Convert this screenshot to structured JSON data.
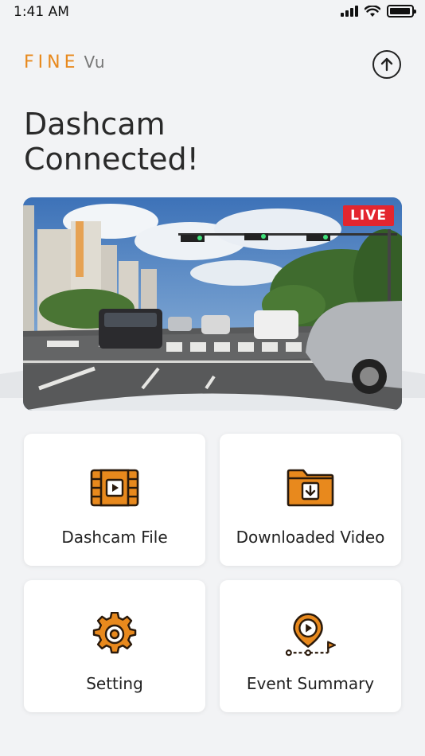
{
  "status_bar": {
    "time": "1:41 AM",
    "battery_level": 0.95
  },
  "header": {
    "brand_part1": "FINE",
    "brand_part2": "Vu",
    "brand_color": "#e8891d"
  },
  "title": {
    "line1": "Dashcam",
    "line2": "Connected!"
  },
  "preview": {
    "badge": "LIVE",
    "badge_color": "#e3262f"
  },
  "actions": [
    {
      "label": "Dashcam File",
      "icon": "film-play-icon"
    },
    {
      "label": "Downloaded Video",
      "icon": "folder-download-icon"
    },
    {
      "label": "Setting",
      "icon": "gear-icon"
    },
    {
      "label": "Event Summary",
      "icon": "event-pin-icon"
    }
  ]
}
